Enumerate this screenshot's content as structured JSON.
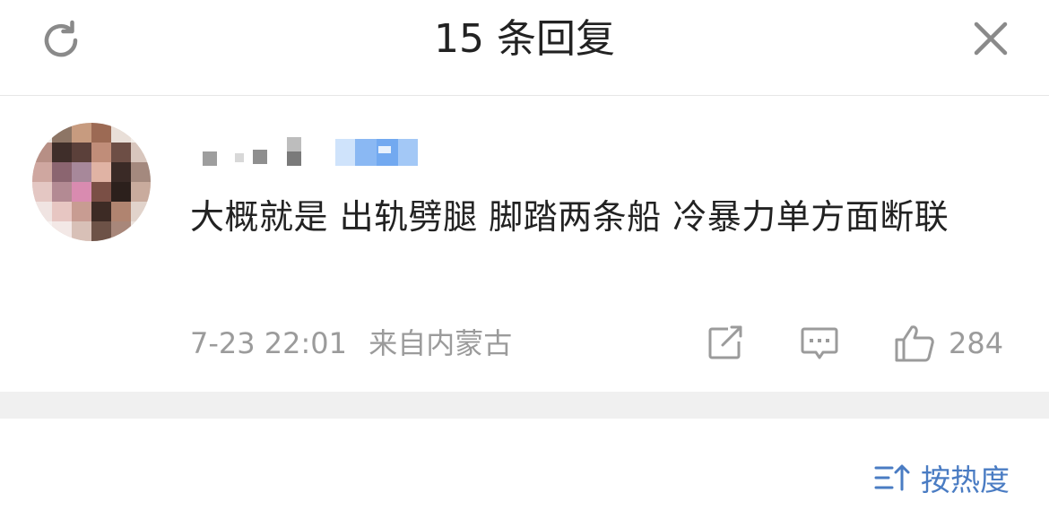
{
  "header": {
    "title": "15 条回复",
    "refresh_icon": "refresh-icon",
    "close_icon": "close-icon"
  },
  "comment": {
    "avatar_icon": "avatar",
    "text": "大概就是 出轨劈腿 脚踏两条船 冷暴力单方面断联",
    "date": "7-23 22:01",
    "location": "来自内蒙古",
    "like_count": "284",
    "share_icon": "share-icon",
    "reply_icon": "comment-icon",
    "like_icon": "thumbs-up-icon"
  },
  "sort": {
    "label": "按热度",
    "icon": "sort-icon",
    "accent_color": "#4a7cc3"
  },
  "colors": {
    "meta_text": "#9b9b9b",
    "divider": "#f0f0f0"
  }
}
